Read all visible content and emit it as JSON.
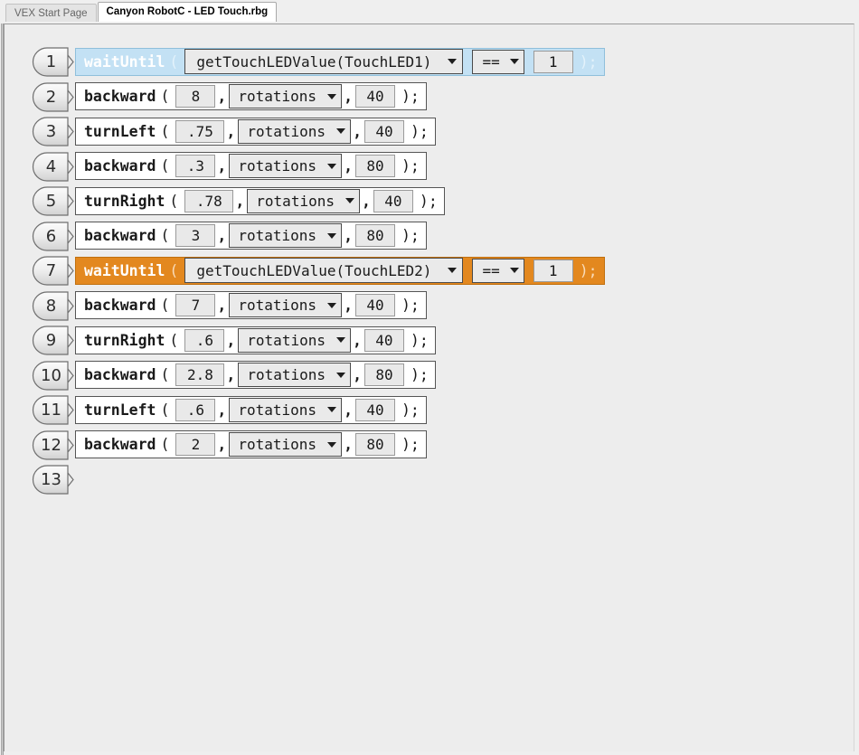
{
  "window": {
    "tabs": [
      {
        "label": "VEX Start Page",
        "active": false
      },
      {
        "label": "Canyon RobotC - LED Touch.rbg",
        "active": true
      }
    ]
  },
  "colors": {
    "canvas": "#ededed",
    "highlight_blue": "#c3e1f4",
    "highlight_orange": "#e3881f",
    "field_bg": "#e9e9e9",
    "stmt_bg": "#ffffff"
  },
  "editor": {
    "unit_label": "rotations",
    "comparison_operator": "==",
    "open_paren": "(",
    "close_paren": ");",
    "comma": ",",
    "lines": [
      {
        "number": "1",
        "kind": "waitUntil",
        "keyword": "waitUntil",
        "sensor": "getTouchLEDValue(TouchLED1)",
        "operator": "==",
        "value": "1",
        "highlight": "blue"
      },
      {
        "number": "2",
        "kind": "motion",
        "keyword": "backward",
        "distance": "8",
        "unit": "rotations",
        "speed": "40",
        "highlight": "none"
      },
      {
        "number": "3",
        "kind": "motion",
        "keyword": "turnLeft",
        "distance": ".75",
        "unit": "rotations",
        "speed": "40",
        "highlight": "none"
      },
      {
        "number": "4",
        "kind": "motion",
        "keyword": "backward",
        "distance": ".3",
        "unit": "rotations",
        "speed": "80",
        "highlight": "none"
      },
      {
        "number": "5",
        "kind": "motion",
        "keyword": "turnRight",
        "distance": ".78",
        "unit": "rotations",
        "speed": "40",
        "highlight": "none"
      },
      {
        "number": "6",
        "kind": "motion",
        "keyword": "backward",
        "distance": "3",
        "unit": "rotations",
        "speed": "80",
        "highlight": "none"
      },
      {
        "number": "7",
        "kind": "waitUntil",
        "keyword": "waitUntil",
        "sensor": "getTouchLEDValue(TouchLED2)",
        "operator": "==",
        "value": "1",
        "highlight": "orange"
      },
      {
        "number": "8",
        "kind": "motion",
        "keyword": "backward",
        "distance": "7",
        "unit": "rotations",
        "speed": "40",
        "highlight": "none"
      },
      {
        "number": "9",
        "kind": "motion",
        "keyword": "turnRight",
        "distance": ".6",
        "unit": "rotations",
        "speed": "40",
        "highlight": "none"
      },
      {
        "number": "10",
        "kind": "motion",
        "keyword": "backward",
        "distance": "2.8",
        "unit": "rotations",
        "speed": "80",
        "highlight": "none"
      },
      {
        "number": "11",
        "kind": "motion",
        "keyword": "turnLeft",
        "distance": ".6",
        "unit": "rotations",
        "speed": "40",
        "highlight": "none"
      },
      {
        "number": "12",
        "kind": "motion",
        "keyword": "backward",
        "distance": "2",
        "unit": "rotations",
        "speed": "80",
        "highlight": "none"
      },
      {
        "number": "13",
        "kind": "empty",
        "highlight": "none"
      }
    ]
  }
}
